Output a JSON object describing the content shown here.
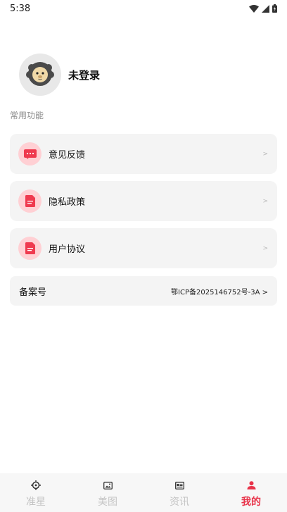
{
  "status_bar": {
    "time": "5:38",
    "icons": [
      "wifi-icon",
      "signal-icon",
      "battery-icon"
    ]
  },
  "profile": {
    "avatar_icon": "lion-avatar-icon",
    "name": "未登录"
  },
  "section": {
    "title": "常用功能"
  },
  "menu": [
    {
      "label": "意见反馈",
      "icon": "feedback-icon",
      "arrow": ">"
    },
    {
      "label": "隐私政策",
      "icon": "document-icon",
      "arrow": ">"
    },
    {
      "label": "用户协议",
      "icon": "document-icon",
      "arrow": ">"
    }
  ],
  "record": {
    "label": "备案号",
    "value": "鄂ICP备2025146752号-3A >"
  },
  "tabs": [
    {
      "label": "准星",
      "icon": "crosshair-icon",
      "active": false
    },
    {
      "label": "美图",
      "icon": "image-icon",
      "active": false
    },
    {
      "label": "资讯",
      "icon": "news-icon",
      "active": false
    },
    {
      "label": "我的",
      "icon": "profile-icon",
      "active": true
    }
  ],
  "colors": {
    "accent": "#e8344a",
    "icon_bg": "#ffd0d4",
    "card_bg": "#f4f4f4",
    "tab_inactive": "#c4c4c4"
  }
}
